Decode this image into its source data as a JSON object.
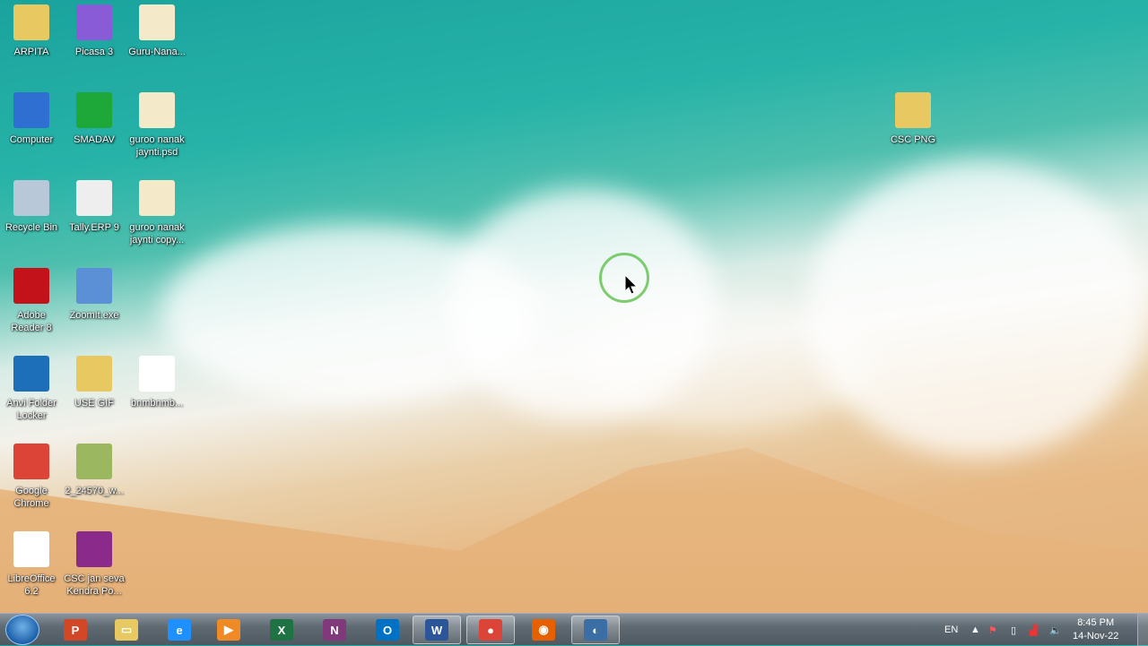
{
  "desktop_icons": [
    {
      "label": "ARPITA",
      "icon": "user-folder-icon",
      "color": "#e8c860"
    },
    {
      "label": "Picasa 3",
      "icon": "picasa-icon",
      "color": "#8a5bd6"
    },
    {
      "label": "Guru-Nana...",
      "icon": "image-file-icon",
      "color": "#f4e9c8"
    },
    {
      "label": "Computer",
      "icon": "computer-icon",
      "color": "#2f6fd1"
    },
    {
      "label": "SMADAV",
      "icon": "smadav-icon",
      "color": "#1fa83a"
    },
    {
      "label": "guroo nanak jaynti.psd",
      "icon": "psd-file-icon",
      "color": "#f4e9c8"
    },
    {
      "label": "Recycle Bin",
      "icon": "recycle-bin-icon",
      "color": "#b8c8d8"
    },
    {
      "label": "Tally.ERP 9",
      "icon": "tally-icon",
      "color": "#eeeeee"
    },
    {
      "label": "guroo nanak jaynti copy...",
      "icon": "image-file-icon",
      "color": "#f4e9c8"
    },
    {
      "label": "Adobe Reader 8",
      "icon": "adobe-reader-icon",
      "color": "#c4121a"
    },
    {
      "label": "ZoomIt.exe",
      "icon": "zoomit-icon",
      "color": "#5b8fd6"
    },
    {
      "label": "Anvi Folder Locker",
      "icon": "folder-locker-icon",
      "color": "#1c6fb8"
    },
    {
      "label": "USE GIF",
      "icon": "folder-icon",
      "color": "#e8c860"
    },
    {
      "label": "bnmbnmb...",
      "icon": "image-file-icon",
      "color": "#ffffff"
    },
    {
      "label": "Google Chrome",
      "icon": "chrome-icon",
      "color": "#db4437"
    },
    {
      "label": "2_24570_w...",
      "icon": "image-file-icon",
      "color": "#9bb860"
    },
    {
      "label": "LibreOffice 6.2",
      "icon": "libreoffice-icon",
      "color": "#ffffff"
    },
    {
      "label": "CSC jan seva Kendra Po...",
      "icon": "winrar-archive-icon",
      "color": "#8a2a8a"
    },
    {
      "label": "CSC PNG",
      "icon": "folder-icon",
      "color": "#e8c860"
    }
  ],
  "taskbar": {
    "items": [
      {
        "name": "powerpoint",
        "glyph": "P",
        "color": "#d24726",
        "active": false
      },
      {
        "name": "file-explorer",
        "glyph": "▭",
        "color": "#e8c860",
        "active": false
      },
      {
        "name": "internet-explorer",
        "glyph": "e",
        "color": "#1e90ff",
        "active": false
      },
      {
        "name": "media-player",
        "glyph": "▶",
        "color": "#f08a24",
        "active": false
      },
      {
        "name": "excel",
        "glyph": "X",
        "color": "#1f7244",
        "active": false
      },
      {
        "name": "onenote",
        "glyph": "N",
        "color": "#80397b",
        "active": false
      },
      {
        "name": "outlook",
        "glyph": "O",
        "color": "#0072c6",
        "active": false
      },
      {
        "name": "word",
        "glyph": "W",
        "color": "#2b579a",
        "active": true
      },
      {
        "name": "chrome",
        "glyph": "●",
        "color": "#db4437",
        "active": true
      },
      {
        "name": "firefox",
        "glyph": "◉",
        "color": "#e66000",
        "active": false
      },
      {
        "name": "recorder",
        "glyph": "◐",
        "color": "#3a6ea5",
        "active": true
      }
    ],
    "language": "EN",
    "time": "8:45 PM",
    "date": "14-Nov-22"
  }
}
